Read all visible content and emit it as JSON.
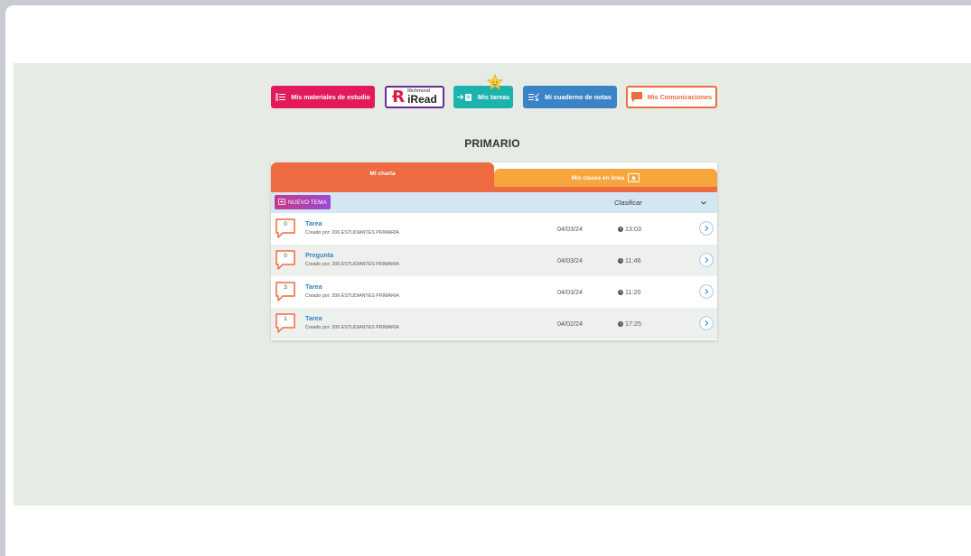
{
  "nav": {
    "materiales": "Mis materiales de estudio",
    "iread_small": "Richmond",
    "iread_big": "iRead",
    "tareas": "Mis tareas",
    "cuaderno": "Mi cuaderno de notas",
    "comunicaciones": "Mis Comunicaciones"
  },
  "page_title": "PRIMARIO",
  "tabs": {
    "charla": "Mi charla",
    "clases": "Mis clases en línea"
  },
  "toolbar": {
    "new_topic": "NUEVO TEMA",
    "sort": "Clasificar"
  },
  "rows": [
    {
      "count": "0",
      "title": "Tarea",
      "author": "Creado por: 206 ESTUDIANTES PRIMARIA",
      "date": "04/03/24",
      "time": "13:03"
    },
    {
      "count": "0",
      "title": "Pregunta",
      "author": "Creado por: 206 ESTUDIANTES PRIMARIA",
      "date": "04/03/24",
      "time": "11:46"
    },
    {
      "count": "3",
      "title": "Tarea",
      "author": "Creado por: 206 ESTUDIANTES PRIMARIA",
      "date": "04/03/24",
      "time": "11:20"
    },
    {
      "count": "1",
      "title": "Tarea",
      "author": "Creado por: 206 ESTUDIANTES PRIMARIA",
      "date": "04/02/24",
      "time": "17:25"
    }
  ],
  "colors": {
    "materiales": "#e2195b",
    "tareas": "#1db3ad",
    "cuaderno": "#3a83c6",
    "comunicaciones": "#f06c3c",
    "tab_active": "#ee6a41",
    "tab_inactive": "#f7a53c"
  }
}
